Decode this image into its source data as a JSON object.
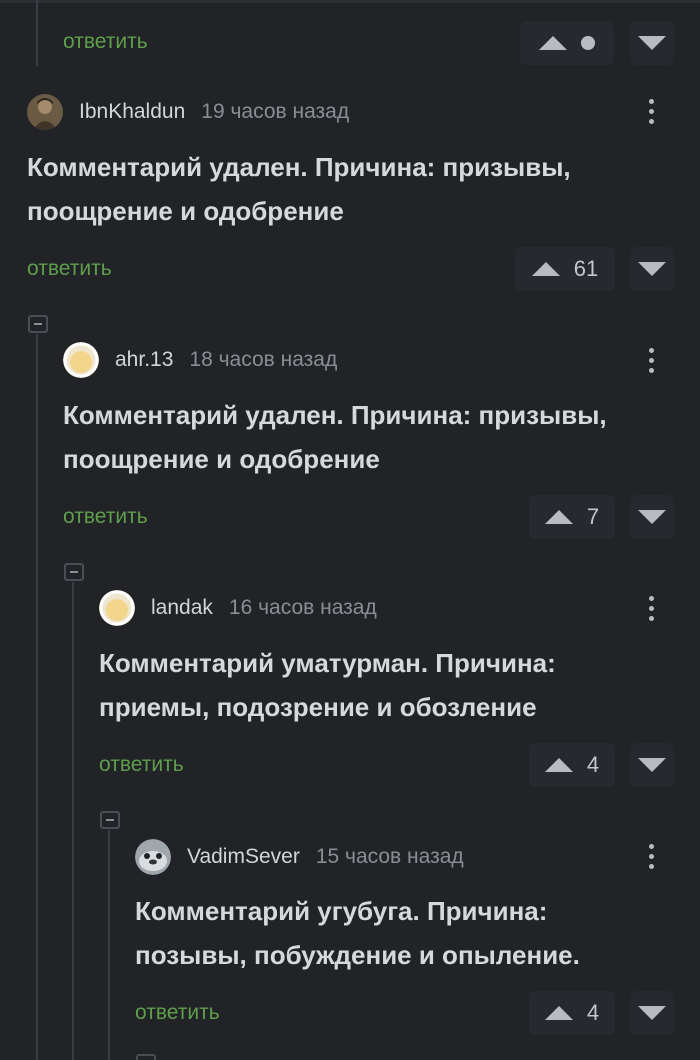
{
  "colors": {
    "background": "#212327",
    "reply_link": "#5f9e4d",
    "text": "#d6d8dc",
    "meta": "#8a8d93"
  },
  "top_item": {
    "reply_label": "ответить",
    "vote_up_icon": "arrow-up-icon",
    "vote_down_icon": "arrow-down-icon"
  },
  "comments": [
    {
      "username": "IbnKhaldun",
      "time": "19 часов назад",
      "text_lines": [
        "Комментарий удален. Причина: призывы,",
        "поощрение и одобрение"
      ],
      "reply_label": "ответить",
      "score": "61",
      "avatar_icon": "portrait-avatar"
    },
    {
      "username": "ahr.13",
      "time": "18 часов назад",
      "text_lines": [
        "Комментарий удален. Причина: призывы,",
        "поощрение и одобрение"
      ],
      "reply_label": "ответить",
      "score": "7",
      "avatar_icon": "pale-avatar"
    },
    {
      "username": "landak",
      "time": "16 часов назад",
      "text_lines": [
        "Комментарий уматурман. Причина:",
        "приемы, подозрение и обозление"
      ],
      "reply_label": "ответить",
      "score": "4",
      "avatar_icon": "pale-avatar"
    },
    {
      "username": "VadimSever",
      "time": "15 часов назад",
      "text_lines": [
        "Комментарий угубуга. Причина:",
        "позывы, побуждение и опыление."
      ],
      "reply_label": "ответить",
      "score": "4",
      "avatar_icon": "seal-avatar"
    }
  ]
}
